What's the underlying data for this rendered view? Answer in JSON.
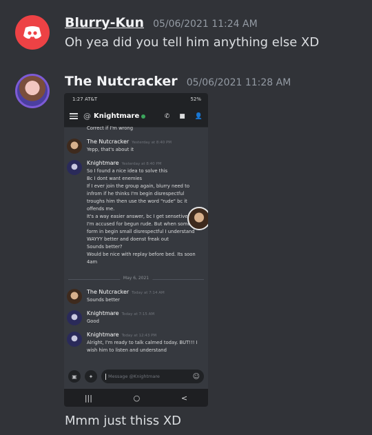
{
  "messages": [
    {
      "username": "Blurry-Kun",
      "timestamp": "05/06/2021 11:24 AM",
      "text": "Oh yea did you tell him anything else XD"
    },
    {
      "username": "The Nutcracker",
      "timestamp": "05/06/2021 11:28 AM",
      "text": "Mmm just thiss XD"
    }
  ],
  "phone": {
    "status_time": "1:27 AT&T",
    "status_right": "52%",
    "channel": "Knightmare",
    "channel_prefix": "@",
    "cut_line": "Correct if I'm wrong",
    "date_divider": "May 6, 2021",
    "input_placeholder": "Message @Knightmare",
    "chat": [
      {
        "author": "The Nutcracker",
        "time": "Yesterday at 8:40 PM",
        "lines": [
          "Yepp, that's about it"
        ]
      },
      {
        "author": "Knightmare",
        "time": "Yesterday at 8:40 PM",
        "lines": [
          "So I found a nice idea to solve this",
          "Bc I dont want enemies",
          "If I ever join the group again, blurry need to",
          "infrom if he thinks I'm begin disrespectful",
          "troughs him then use the word \"rude\" bc it",
          "offends me.",
          "It's a way easier answer,  bc I get sensetive",
          "I'm accused for begun rude. But when some",
          "form in begin small disrespectful I understand",
          "WAYYY better and doenst freak out",
          "Sounds better?",
          "Would be nice with replay before bed. Its soon",
          "4am"
        ]
      },
      {
        "author": "The Nutcracker",
        "time": "Today at 7:14 AM",
        "lines": [
          "Sounds better"
        ]
      },
      {
        "author": "Knightmare",
        "time": "Today at 7:15 AM",
        "lines": [
          "Good"
        ]
      },
      {
        "author": "Knightmare",
        "time": "Today at 12:43 PM",
        "lines": [
          "Alright, I'm ready to talk calmed today. BUT!!! I",
          "wish him to listen and understand"
        ]
      }
    ]
  }
}
